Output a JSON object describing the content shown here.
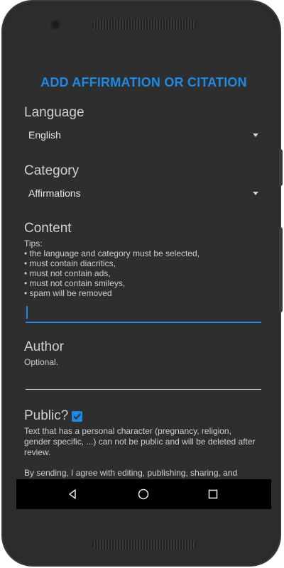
{
  "header": {
    "title": "ADD AFFIRMATION OR CITATION"
  },
  "language": {
    "label": "Language",
    "selected": "English"
  },
  "category": {
    "label": "Category",
    "selected": "Affirmations"
  },
  "content": {
    "label": "Content",
    "tips_title": "Tips:",
    "tips": [
      "• the language and category must be selected,",
      "• must contain diacritics,",
      "• must not contain ads,",
      "• must not contain smileys,",
      "• spam will be removed"
    ],
    "value": ""
  },
  "author": {
    "label": "Author",
    "hint": "Optional.",
    "value": ""
  },
  "public": {
    "label": "Public?",
    "checked": true,
    "note_line1": "Text that has a personal character (pregnancy, religion,",
    "note_line2": "gender specific, ...) can not be public and will be deleted after",
    "note_line3": "review."
  },
  "agreement": {
    "text": "By sending, I agree with editing, publishing, sharing, and"
  },
  "navbar": {
    "back_icon": "back-triangle-icon",
    "home_icon": "home-circle-icon",
    "recents_icon": "recents-square-icon"
  },
  "colors": {
    "accent": "#1e88e5",
    "background": "#2e2e2e",
    "text": "#d0d0d0"
  }
}
